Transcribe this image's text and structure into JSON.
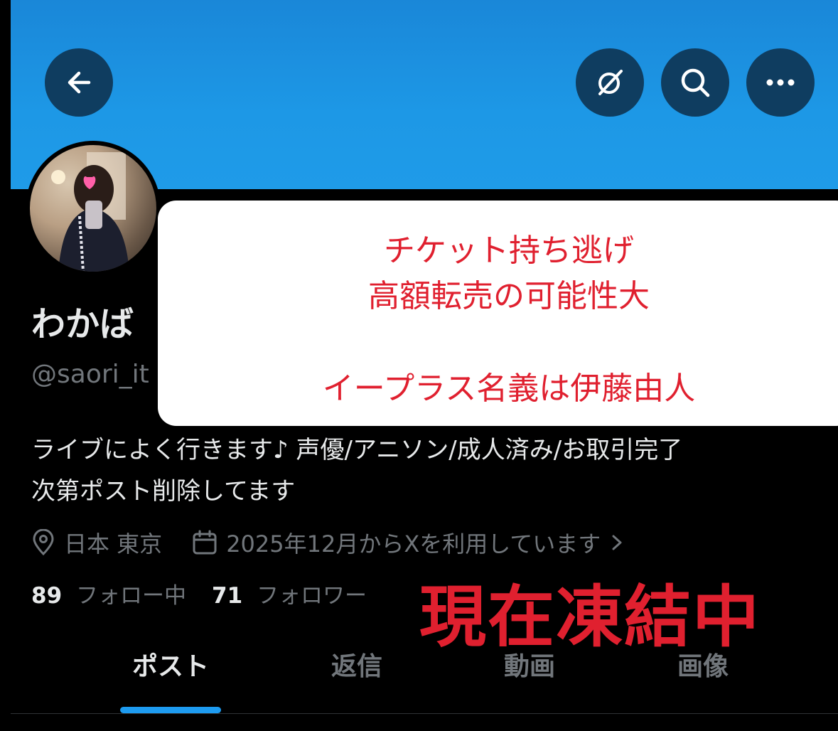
{
  "profile": {
    "display_name": "わかば",
    "handle": "@saori_it",
    "bio_line1": "ライブによく行きます♪ 声優/アニソン/成人済み/お取引完了",
    "bio_line2": "次第ポスト削除してます",
    "location": "日本 東京",
    "joined": "2025年12月からXを利用しています",
    "following_count": "89",
    "following_label": "フォロー中",
    "followers_count": "71",
    "followers_label": "フォロワー"
  },
  "header": {
    "back_icon": "arrow-left-icon",
    "grok_icon": "grok-icon",
    "search_icon": "search-icon",
    "more_icon": "more-icon"
  },
  "overlay": {
    "line1": "チケット持ち逃げ",
    "line2": "高額転売の可能性大",
    "line3": "イープラス名義は伊藤由人",
    "stamp": "現在凍結中"
  },
  "tabs": [
    {
      "label": "ポスト",
      "active": true
    },
    {
      "label": "返信",
      "active": false
    },
    {
      "label": "動画",
      "active": false
    },
    {
      "label": "画像",
      "active": false
    }
  ],
  "colors": {
    "banner": "#1d98e6",
    "accent": "#1d9bf0",
    "overlay_text": "#e0202f",
    "muted": "#71767b"
  }
}
